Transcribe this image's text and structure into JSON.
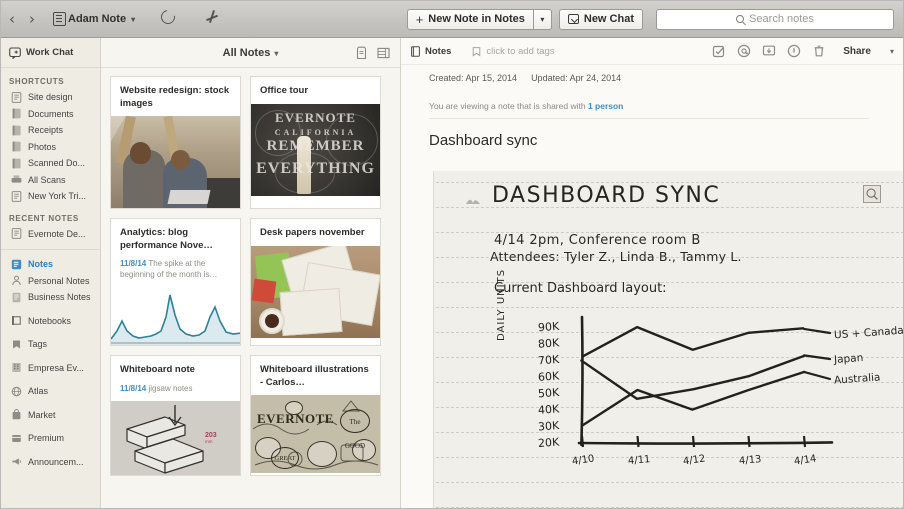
{
  "toolbar": {
    "back_label": "‹",
    "forward_label": "›",
    "account_label": "Adam Note",
    "account_caret": "▾",
    "sync_icon": "sync-icon",
    "skitch_icon": "skitch-icon",
    "new_note_label": "New Note in Notes",
    "new_note_plus": "+",
    "new_note_caret": "▾",
    "new_chat_label": "New Chat",
    "search_placeholder": "Search notes"
  },
  "sidebar": {
    "work_chat_label": "Work Chat",
    "shortcuts_header": "SHORTCUTS",
    "shortcuts": [
      {
        "label": "Site design",
        "icon": "note-icon"
      },
      {
        "label": "Documents",
        "icon": "notebook-icon"
      },
      {
        "label": "Receipts",
        "icon": "notebook-icon"
      },
      {
        "label": "Photos",
        "icon": "notebook-icon"
      },
      {
        "label": "Scanned Do...",
        "icon": "notebook-icon"
      },
      {
        "label": "All Scans",
        "icon": "scanner-icon"
      },
      {
        "label": "New York Tri...",
        "icon": "note-icon"
      }
    ],
    "recent_header": "RECENT NOTES",
    "recent": [
      {
        "label": "Evernote De...",
        "icon": "note-icon"
      }
    ],
    "nav": [
      {
        "label": "Notes",
        "icon": "notes-icon",
        "active": true
      },
      {
        "label": "Personal Notes",
        "icon": "person-icon",
        "active": false
      },
      {
        "label": "Business Notes",
        "icon": "business-icon",
        "active": false
      },
      {
        "label": "Notebooks",
        "icon": "notebooks-icon",
        "active": false
      },
      {
        "label": "Tags",
        "icon": "tag-icon",
        "active": false
      },
      {
        "label": "Empresa Ev...",
        "icon": "building-icon",
        "active": false
      },
      {
        "label": "Atlas",
        "icon": "globe-icon",
        "active": false
      },
      {
        "label": "Market",
        "icon": "bag-icon",
        "active": false
      },
      {
        "label": "Premium",
        "icon": "premium-icon",
        "active": false
      },
      {
        "label": "Announcem...",
        "icon": "megaphone-icon",
        "active": false
      }
    ]
  },
  "notelist": {
    "header_label": "All Notes",
    "header_caret": "▾",
    "view_icons": [
      "snippet-view-icon",
      "card-view-icon"
    ],
    "cards": [
      {
        "title": "Website redesign: stock images",
        "snippet_date": "",
        "snippet": "",
        "thumb": "office-photo"
      },
      {
        "title": "Office tour",
        "snippet_date": "",
        "snippet": "",
        "thumb": "chalkboard-photo"
      },
      {
        "title": "Analytics: blog performance Nove…",
        "snippet_date": "11/8/14",
        "snippet": "The spike at the beginning of the month is…",
        "thumb": "sparkline-chart"
      },
      {
        "title": "Desk papers november",
        "snippet_date": "",
        "snippet": "",
        "thumb": "desk-photo"
      },
      {
        "title": "Whiteboard note",
        "snippet_date": "11/8/14",
        "snippet": "jigsaw notes",
        "thumb": "jigsaw-sketch"
      },
      {
        "title": "Whiteboard illustrations - Carlos…",
        "snippet_date": "",
        "snippet": "",
        "thumb": "doodle-photo"
      }
    ]
  },
  "notepane": {
    "notebook_label": "Notes",
    "tags_placeholder": "click to add tags",
    "tools": [
      "reminder-icon",
      "mention-icon",
      "present-icon",
      "info-icon",
      "trash-icon"
    ],
    "share_label": "Share",
    "share_caret": "▾",
    "created_label": "Created: Apr 15, 2014",
    "updated_label": "Updated: Apr 24, 2014",
    "shared_prefix": "You are viewing a note that is shared with ",
    "shared_count": "1 person",
    "title": "Dashboard sync",
    "handwritten": {
      "heading": "DASHBOARD SYNC",
      "line1": "4/14   2pm,  Conference  room  B",
      "line2": "Attendees:  Tyler Z., Linda B., Tammy L.",
      "line3": "Current  Dashboard  layout:"
    }
  },
  "chart_data": {
    "type": "line",
    "title": "Current Dashboard layout",
    "xlabel": "",
    "ylabel": "DAILY UNITS",
    "x": [
      "4/10",
      "4/11",
      "4/12",
      "4/13",
      "4/14"
    ],
    "ytick_labels": [
      "20K",
      "30K",
      "40K",
      "50K",
      "60K",
      "70K",
      "80K",
      "90K"
    ],
    "ylim": [
      20,
      95
    ],
    "grid": false,
    "legend_position": "right",
    "series": [
      {
        "name": "US + Canada",
        "values": [
          72,
          90,
          76,
          87,
          89
        ]
      },
      {
        "name": "Japan",
        "values": [
          70,
          47,
          53,
          60,
          73
        ]
      },
      {
        "name": "Australia",
        "values": [
          30,
          52,
          40,
          52,
          63
        ]
      }
    ]
  }
}
